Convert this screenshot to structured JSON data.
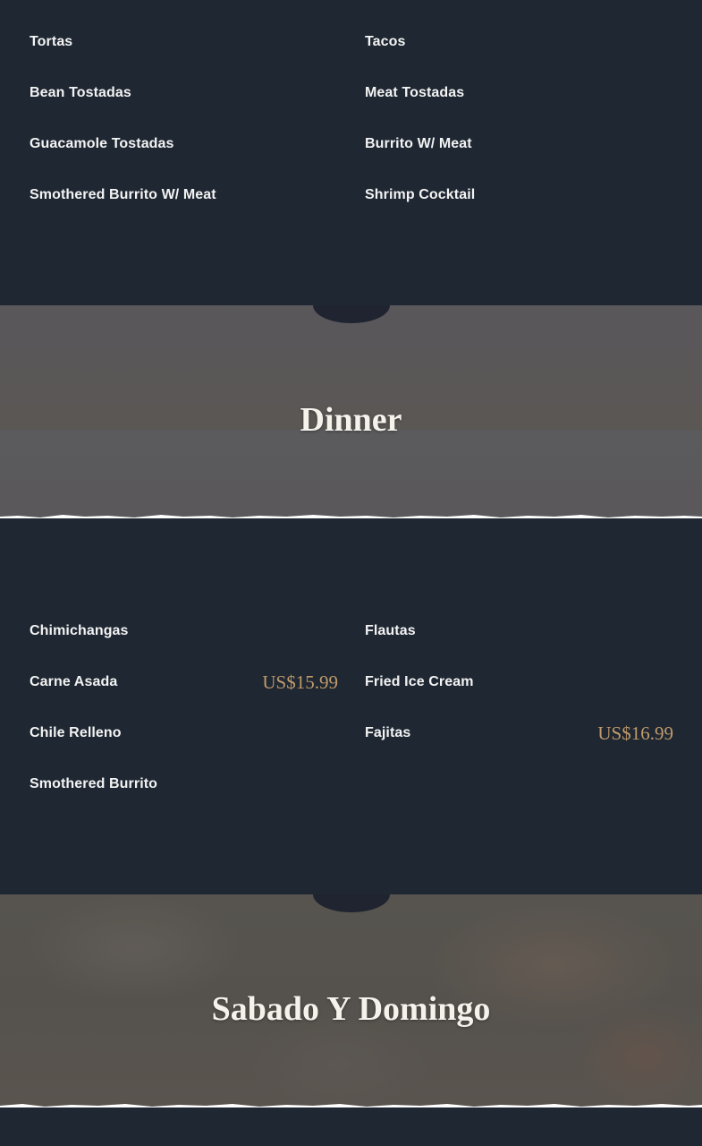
{
  "sections": {
    "lunch": {
      "items": [
        {
          "name": "Tortas",
          "price": ""
        },
        {
          "name": "Tacos",
          "price": ""
        },
        {
          "name": "Bean Tostadas",
          "price": ""
        },
        {
          "name": "Meat Tostadas",
          "price": ""
        },
        {
          "name": "Guacamole Tostadas",
          "price": ""
        },
        {
          "name": "Burrito W/ Meat",
          "price": ""
        },
        {
          "name": "Smothered Burrito W/ Meat",
          "price": ""
        },
        {
          "name": "Shrimp Cocktail",
          "price": ""
        }
      ]
    },
    "dinner": {
      "title": "Dinner",
      "items": [
        {
          "name": "Chimichangas",
          "price": ""
        },
        {
          "name": "Flautas",
          "price": ""
        },
        {
          "name": "Carne Asada",
          "price": "US$15.99"
        },
        {
          "name": "Fried Ice Cream",
          "price": ""
        },
        {
          "name": "Chile Relleno",
          "price": ""
        },
        {
          "name": "Fajitas",
          "price": "US$16.99"
        },
        {
          "name": "Smothered Burrito",
          "price": ""
        }
      ]
    },
    "weekend": {
      "title": "Sabado Y Domingo"
    }
  },
  "colors": {
    "background": "#1e2732",
    "item_text": "#f3f3f3",
    "price_accent": "#c09a6b",
    "heading_text": "#f5f2ec"
  }
}
